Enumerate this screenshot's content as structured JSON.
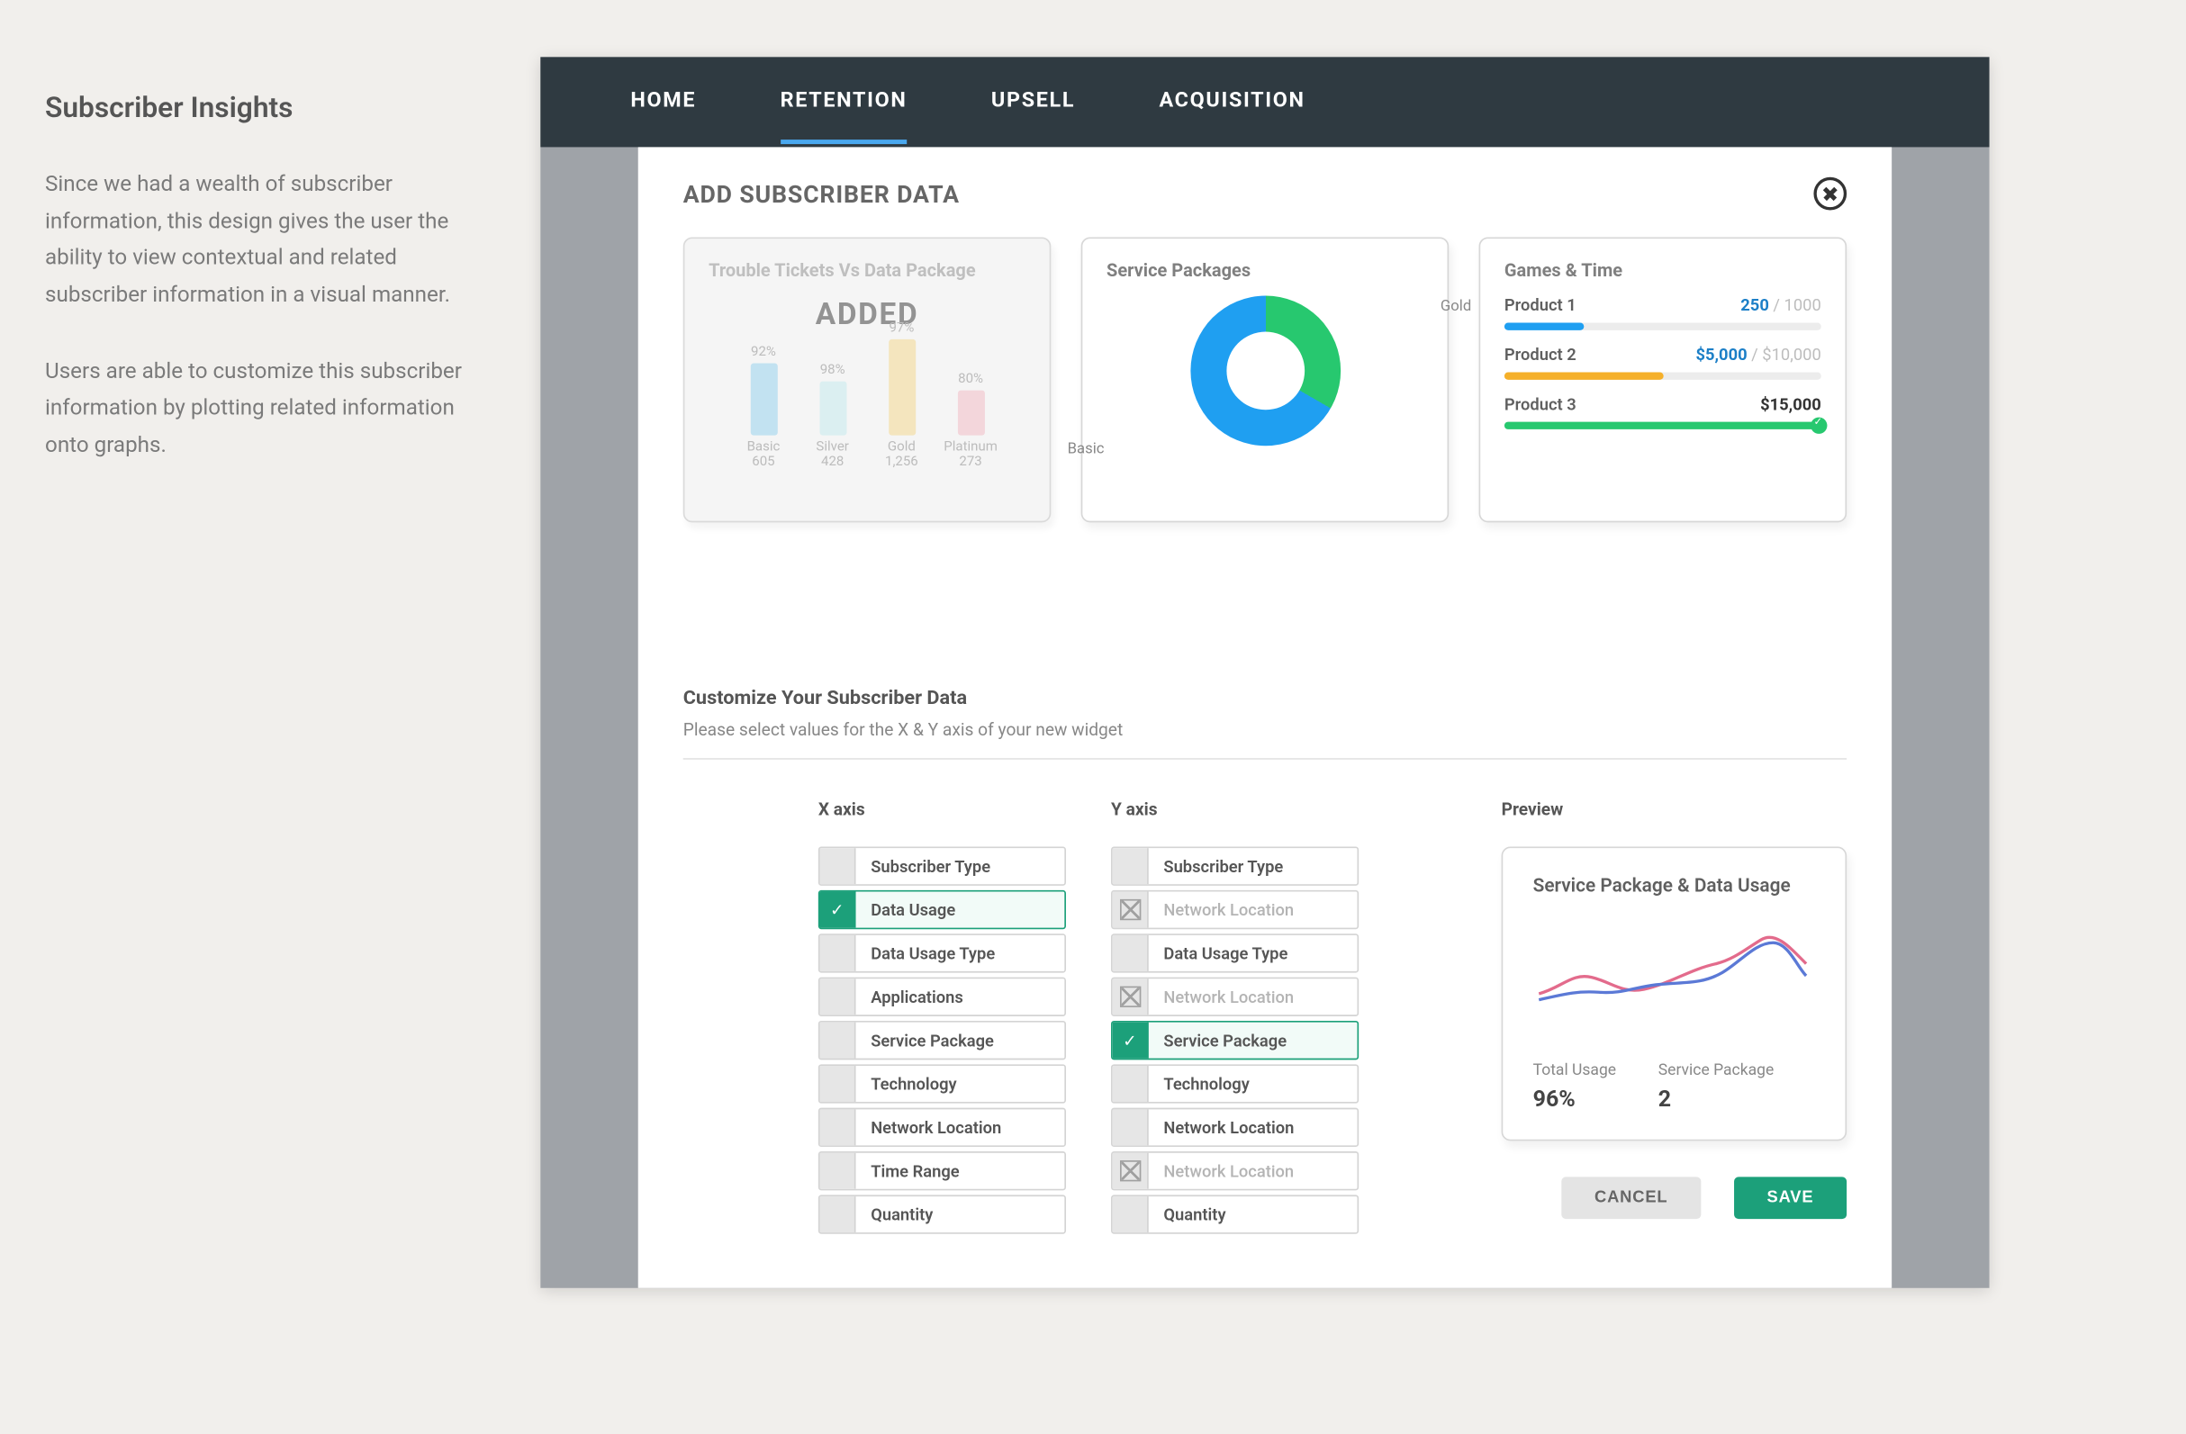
{
  "sidebar": {
    "title": "Subscriber Insights",
    "para1": "Since we had a wealth of subscriber information, this design gives the user the ability to view contextual and related subscriber information in a visual manner.",
    "para2": "Users are able to customize this subscriber information by plotting related information onto graphs."
  },
  "tabs": {
    "home": "HOME",
    "retention": "RETENTION",
    "upsell": "UPSELL",
    "acquisition": "ACQUISITION"
  },
  "panel": {
    "title": "ADD SUBSCRIBER DATA"
  },
  "cards": {
    "tickets": {
      "title": "Trouble Tickets Vs Data Package",
      "added": "ADDED",
      "bars": [
        {
          "pct": "92%",
          "name": "Basic",
          "val": "605",
          "h": 48,
          "color": "#bcdff0"
        },
        {
          "pct": "98%",
          "name": "Silver",
          "val": "428",
          "h": 36,
          "color": "#d8eef0"
        },
        {
          "pct": "97%",
          "name": "Gold",
          "val": "1,256",
          "h": 64,
          "color": "#f3e3b7"
        },
        {
          "pct": "80%",
          "name": "Platinum",
          "val": "273",
          "h": 30,
          "color": "#f2d2d8"
        }
      ]
    },
    "service": {
      "title": "Service Packages",
      "gold": "Gold",
      "basic": "Basic"
    },
    "games": {
      "title": "Games & Time",
      "rows": [
        {
          "name": "Product 1",
          "cur": "250",
          "max": "/ 1000",
          "pct": 25,
          "color": "#1f9ff1"
        },
        {
          "name": "Product 2",
          "cur": "$5,000",
          "max": "/ $10,000",
          "pct": 50,
          "color": "#f5b02a"
        },
        {
          "name": "Product 3",
          "single": "$15,000",
          "pct": 100,
          "color": "#27c86f"
        }
      ]
    }
  },
  "customize": {
    "heading": "Customize Your Subscriber Data",
    "sub": "Please select values for the X & Y axis of your new widget",
    "xaxis": {
      "label": "X axis",
      "options": [
        {
          "label": "Subscriber Type",
          "state": "normal"
        },
        {
          "label": "Data Usage",
          "state": "selected"
        },
        {
          "label": "Data Usage Type",
          "state": "normal"
        },
        {
          "label": "Applications",
          "state": "normal"
        },
        {
          "label": "Service Package",
          "state": "normal"
        },
        {
          "label": "Technology",
          "state": "normal"
        },
        {
          "label": "Network Location",
          "state": "normal"
        },
        {
          "label": "Time Range",
          "state": "normal"
        },
        {
          "label": "Quantity",
          "state": "normal"
        }
      ]
    },
    "yaxis": {
      "label": "Y axis",
      "options": [
        {
          "label": "Subscriber Type",
          "state": "normal"
        },
        {
          "label": "Network Location",
          "state": "disabled"
        },
        {
          "label": "Data Usage Type",
          "state": "normal"
        },
        {
          "label": "Network Location",
          "state": "disabled"
        },
        {
          "label": "Service Package",
          "state": "selected"
        },
        {
          "label": "Technology",
          "state": "normal"
        },
        {
          "label": "Network Location",
          "state": "normal"
        },
        {
          "label": "Network Location",
          "state": "disabled"
        },
        {
          "label": "Quantity",
          "state": "normal"
        }
      ]
    },
    "preview": {
      "label": "Preview",
      "title": "Service Package & Data Usage",
      "stat1_label": "Total Usage",
      "stat1_value": "96%",
      "stat2_label": "Service Package",
      "stat2_value": "2"
    },
    "buttons": {
      "cancel": "CANCEL",
      "save": "SAVE"
    }
  }
}
